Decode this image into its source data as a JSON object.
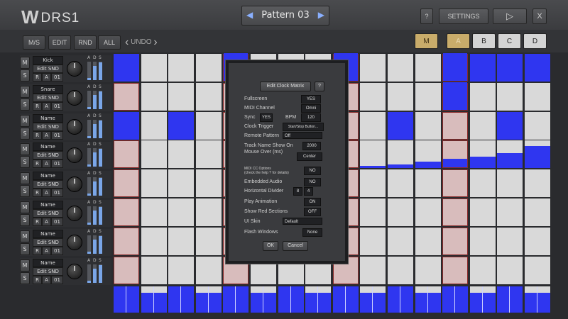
{
  "app": {
    "logo_glyph": "W",
    "title": "DRS1"
  },
  "header": {
    "pattern_name": "Pattern 03",
    "prev_arrow": "◀",
    "next_arrow": "▶",
    "help_label": "?",
    "settings_label": "SETTINGS",
    "play_icon": "▷",
    "close_label": "X"
  },
  "toolbar": {
    "ms_label": "M/S",
    "edit_label": "EDIT",
    "rnd_label": "RND",
    "all_label": "ALL",
    "undo_prev": "‹",
    "undo_label": "UNDO",
    "undo_next": "›",
    "mode_label": "M",
    "banks": [
      "A",
      "B",
      "C",
      "D"
    ]
  },
  "colors": {
    "active": "#2f36f0",
    "empty": "#d9d9d9",
    "empty_alt": "#d8bcbc",
    "accent": "#c9ac6a"
  },
  "tracks": [
    {
      "name": "Kick",
      "edit": "Edit SND",
      "r": "R",
      "a": "A",
      "num": "01",
      "m": "M",
      "s": "S",
      "ads_labels": [
        "A",
        "D",
        "S"
      ],
      "ads": [
        0.1,
        0.75,
        0.95
      ]
    },
    {
      "name": "Snare",
      "edit": "Edit SND",
      "r": "R",
      "a": "A",
      "num": "01",
      "m": "M",
      "s": "S",
      "ads_labels": [
        "A",
        "D",
        "S"
      ],
      "ads": [
        0.1,
        0.75,
        0.95
      ]
    },
    {
      "name": "Name",
      "edit": "Edit SND",
      "r": "R",
      "a": "A",
      "num": "01",
      "m": "M",
      "s": "S",
      "ads_labels": [
        "A",
        "D",
        "S"
      ],
      "ads": [
        0.1,
        0.75,
        0.95
      ]
    },
    {
      "name": "Name",
      "edit": "Edit SND",
      "r": "R",
      "a": "A",
      "num": "01",
      "m": "M",
      "s": "S",
      "ads_labels": [
        "A",
        "D",
        "S"
      ],
      "ads": [
        0.1,
        0.75,
        0.95
      ]
    },
    {
      "name": "Name",
      "edit": "Edit SND",
      "r": "R",
      "a": "A",
      "num": "01",
      "m": "M",
      "s": "S",
      "ads_labels": [
        "A",
        "D",
        "S"
      ],
      "ads": [
        0.1,
        0.75,
        0.95
      ]
    },
    {
      "name": "Name",
      "edit": "Edit SND",
      "r": "R",
      "a": "A",
      "num": "01",
      "m": "M",
      "s": "S",
      "ads_labels": [
        "A",
        "D",
        "S"
      ],
      "ads": [
        0.1,
        0.75,
        0.95
      ]
    },
    {
      "name": "Name",
      "edit": "Edit SND",
      "r": "R",
      "a": "A",
      "num": "01",
      "m": "M",
      "s": "S",
      "ads_labels": [
        "A",
        "D",
        "S"
      ],
      "ads": [
        0.1,
        0.75,
        0.95
      ]
    },
    {
      "name": "Name",
      "edit": "Edit SND",
      "r": "R",
      "a": "A",
      "num": "01",
      "m": "M",
      "s": "S",
      "ads_labels": [
        "A",
        "D",
        "S"
      ],
      "ads": [
        0.1,
        0.75,
        0.95
      ]
    }
  ],
  "grid": [
    [
      1,
      0,
      0,
      0,
      1,
      0,
      0,
      0,
      1,
      0,
      0,
      0,
      1,
      1,
      1,
      1
    ],
    [
      0,
      0,
      0,
      0,
      0,
      0,
      0,
      0,
      0,
      0,
      0,
      0,
      1,
      0,
      0,
      0
    ],
    [
      1,
      0,
      1,
      0,
      0,
      0,
      0,
      0,
      0,
      0,
      1,
      0,
      0,
      0,
      1,
      0
    ],
    [
      0,
      0,
      0,
      0,
      0,
      0,
      0,
      0,
      0,
      0.08,
      0.14,
      0.22,
      0.3,
      0.4,
      0.55,
      0.8
    ],
    [
      0,
      0,
      0,
      0,
      0,
      0,
      0,
      0,
      0,
      0,
      0,
      0,
      0,
      0,
      0,
      0
    ],
    [
      0,
      0,
      0,
      0,
      0,
      0,
      0,
      0,
      0,
      0,
      0,
      0,
      0,
      0,
      0,
      0
    ],
    [
      0,
      0,
      0,
      0,
      0,
      0,
      0,
      0,
      0,
      0,
      0,
      0,
      0,
      0,
      0,
      0
    ],
    [
      0,
      0,
      0,
      0,
      0,
      0,
      0,
      0,
      0,
      0,
      0,
      0,
      0,
      0,
      0,
      0
    ]
  ],
  "grid_tint": [
    [
      0,
      0,
      0,
      0,
      1,
      0,
      0,
      0,
      1,
      0,
      0,
      0,
      1,
      0,
      0,
      0
    ],
    [
      1,
      0,
      0,
      0,
      1,
      0,
      0,
      0,
      1,
      0,
      0,
      0,
      1,
      0,
      0,
      0
    ],
    [
      0,
      0,
      0,
      0,
      1,
      0,
      0,
      0,
      1,
      0,
      0,
      0,
      1,
      0,
      0,
      0
    ],
    [
      1,
      0,
      0,
      0,
      1,
      0,
      0,
      0,
      1,
      0,
      0,
      0,
      1,
      0,
      0,
      0
    ],
    [
      1,
      0,
      0,
      0,
      1,
      0,
      0,
      0,
      1,
      0,
      0,
      0,
      1,
      0,
      0,
      0
    ],
    [
      1,
      0,
      0,
      0,
      1,
      0,
      0,
      0,
      1,
      0,
      0,
      0,
      1,
      0,
      0,
      0
    ],
    [
      1,
      0,
      0,
      0,
      1,
      0,
      0,
      0,
      1,
      0,
      0,
      0,
      1,
      0,
      0,
      0
    ],
    [
      1,
      0,
      0,
      0,
      1,
      0,
      0,
      0,
      1,
      0,
      0,
      0,
      1,
      0,
      0,
      0
    ]
  ],
  "velocity_row": [
    1,
    0.75,
    1,
    0.75,
    1,
    0.75,
    1,
    0.75,
    1,
    0.75,
    1,
    0.75,
    1,
    0.75,
    1,
    0.75
  ],
  "dialog": {
    "edit_clock_matrix": "Edit Clock Matrix",
    "help": "?",
    "fullscreen_label": "Fullscreen",
    "fullscreen_value": "YES",
    "midi_channel_label": "MIDI Channel",
    "midi_channel_value": "Omni",
    "sync_label": "Sync",
    "sync_value": "YES",
    "bpm_label": "BPM",
    "bpm_value": "120",
    "clock_trigger_label": "Clock Trigger",
    "clock_trigger_value": "Start/Stop Button...",
    "remote_pattern_label": "Remote Pattern",
    "remote_pattern_value": "Off",
    "track_name_label_1": "Track Name Show On",
    "track_name_label_2": "Mouse Over (ms)",
    "track_name_value": "2000",
    "align_value": "Center",
    "midi_cc_label_1": "MIDI CC Options",
    "midi_cc_label_2": "(check the help ? for details)",
    "midi_cc_value": "NO",
    "embedded_audio_label": "Embedded Audio",
    "embedded_audio_value": "NO",
    "horizontal_divider_label": "Horizontal Divider",
    "hdiv_a": "8",
    "hdiv_b": "4",
    "play_animation_label": "Play Animation",
    "play_animation_value": "ON",
    "show_red_label": "Show Red Sections",
    "show_red_value": "OFF",
    "ui_skin_label": "UI Skin",
    "ui_skin_value": "Default",
    "flash_windows_label": "Flash Windows",
    "flash_windows_value": "None",
    "ok_label": "OK",
    "cancel_label": "Cancel"
  }
}
